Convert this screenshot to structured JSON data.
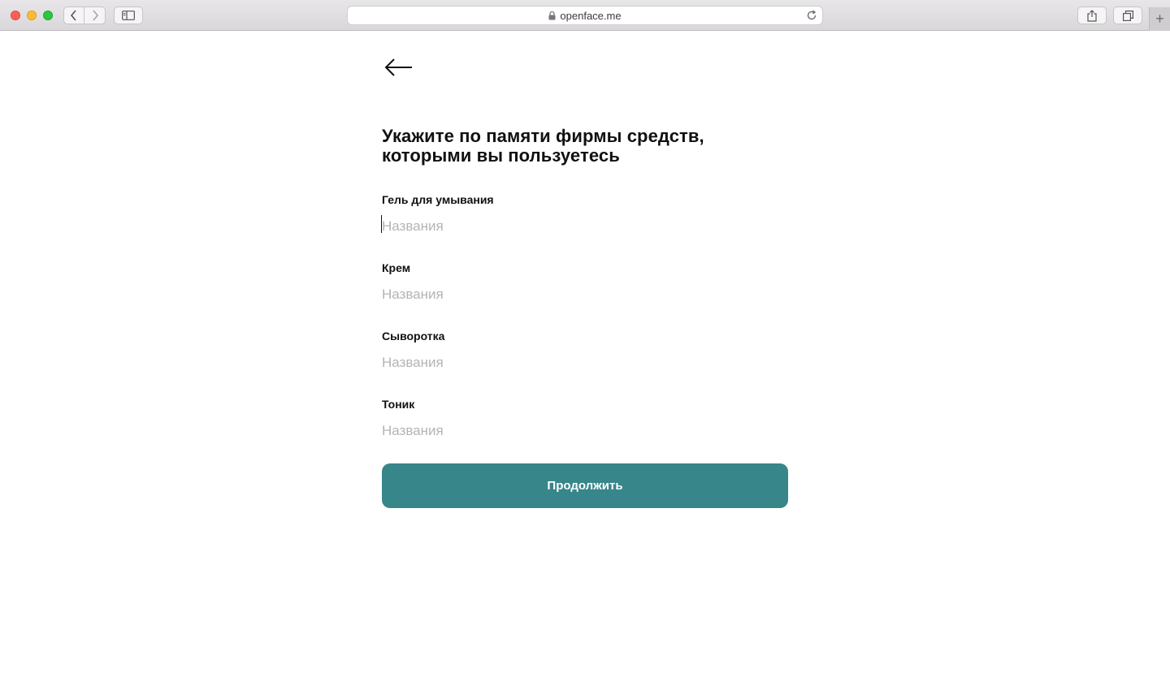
{
  "browser": {
    "url": "openface.me",
    "icons": [
      "back-icon",
      "forward-icon",
      "sidebar-icon",
      "lock-icon",
      "reload-icon",
      "share-icon",
      "tabs-icon",
      "plus-icon"
    ],
    "new_tab_label": "+"
  },
  "page": {
    "back_icon": "arrow-left-icon",
    "title_line1": "Укажите по памяти фирмы средств,",
    "title_line2": "которыми вы пользуетесь",
    "fields": [
      {
        "label": "Гель для умывания",
        "value": "",
        "placeholder": "Названия"
      },
      {
        "label": "Крем",
        "value": "",
        "placeholder": "Названия"
      },
      {
        "label": "Сыворотка",
        "value": "",
        "placeholder": "Названия"
      },
      {
        "label": "Тоник",
        "value": "",
        "placeholder": "Названия"
      }
    ],
    "continue_label": "Продолжить",
    "accent_color": "#37868a"
  }
}
